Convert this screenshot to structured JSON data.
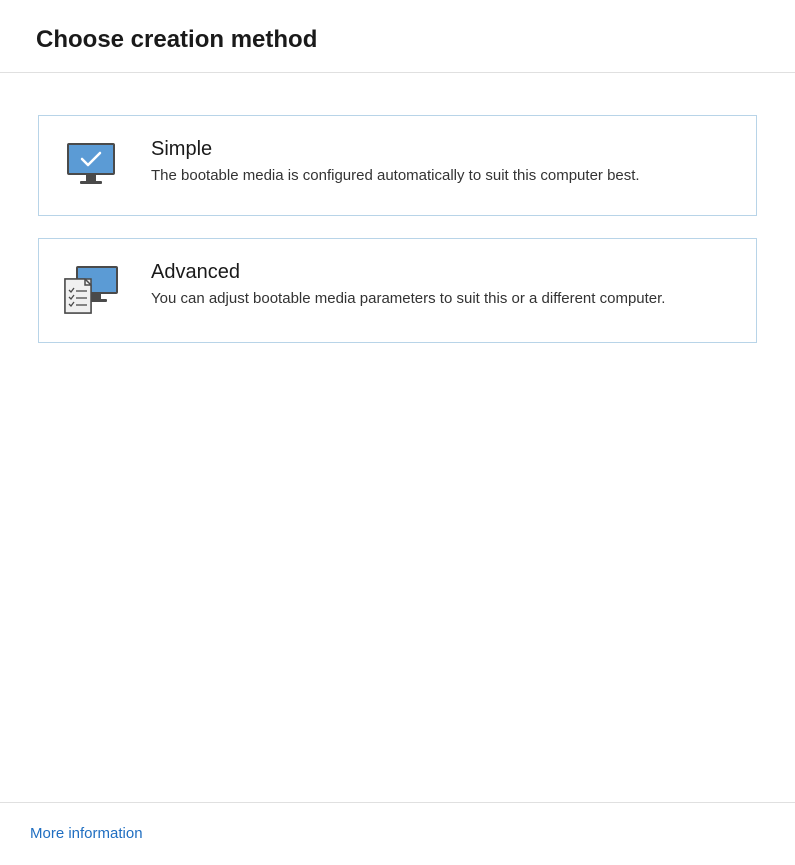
{
  "header": {
    "title": "Choose creation method"
  },
  "options": {
    "simple": {
      "title": "Simple",
      "description": "The bootable media is configured automatically to suit this computer best.",
      "icon": "monitor-check-icon"
    },
    "advanced": {
      "title": "Advanced",
      "description": "You can adjust bootable media parameters to suit this or a different computer.",
      "icon": "monitor-checklist-icon"
    }
  },
  "footer": {
    "more_info": "More information"
  }
}
